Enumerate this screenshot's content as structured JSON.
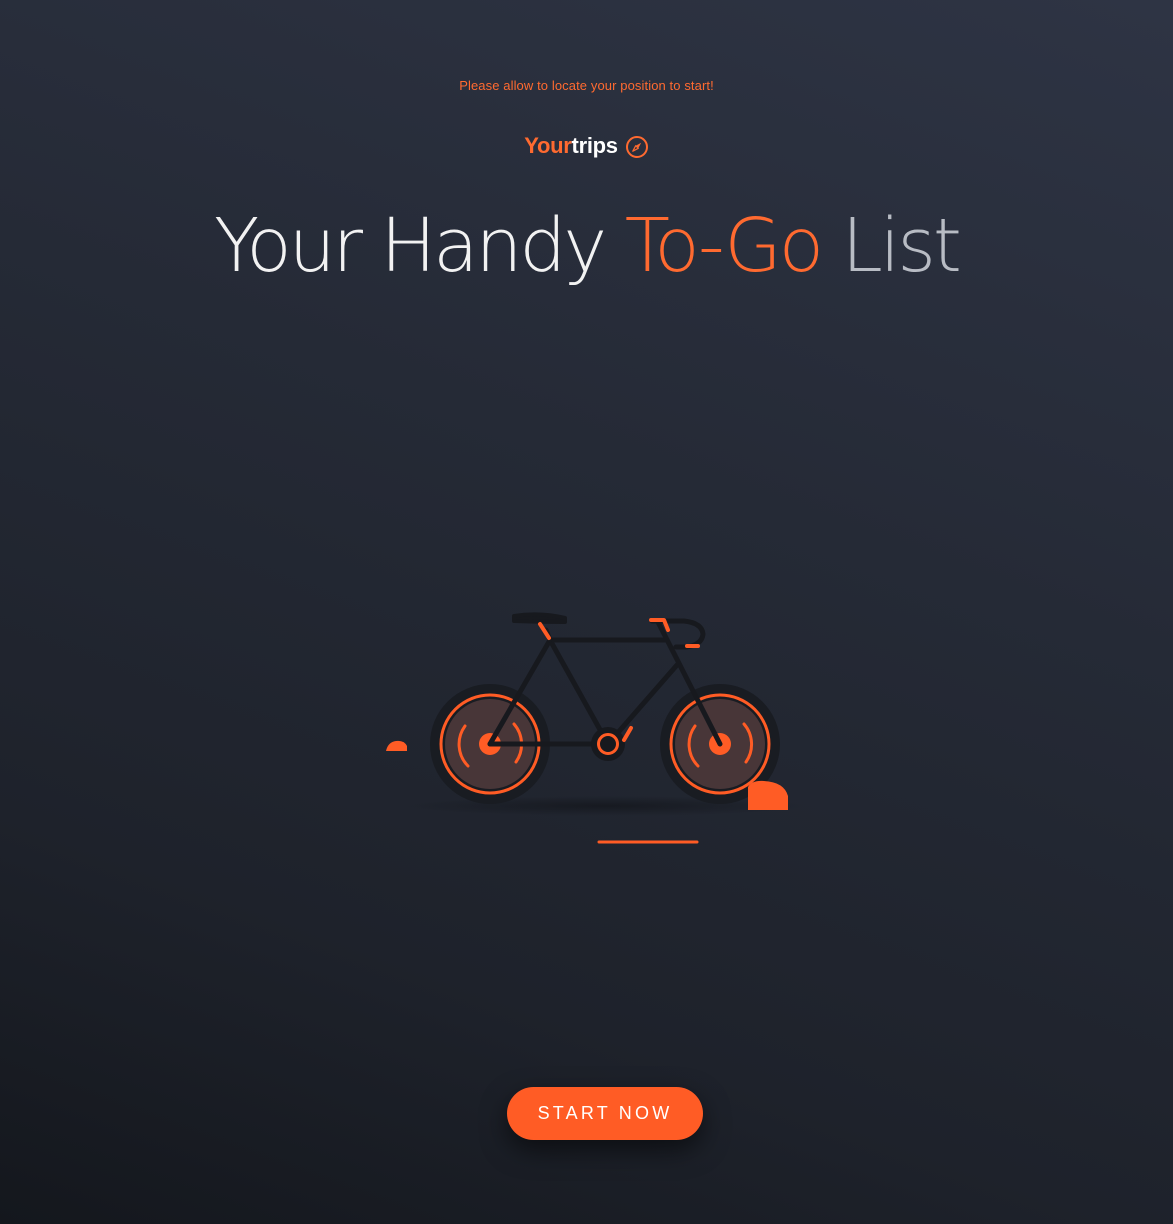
{
  "notice": "Please allow to locate your position to start!",
  "brand": {
    "your": "Your",
    "trips": "trips",
    "icon": "compass-icon"
  },
  "headline": {
    "part1": "Your Handy ",
    "part2": "To-Go",
    "part3": " List"
  },
  "illustration": {
    "icon": "bicycle-illustration"
  },
  "cta": {
    "label": "START NOW"
  },
  "colors": {
    "accent": "#ff6a30",
    "button": "#ff5c25",
    "background_top": "#2e3444",
    "background_bottom": "#14171d",
    "text_light": "#f2f2f2",
    "text_muted": "#b8bcc4"
  }
}
